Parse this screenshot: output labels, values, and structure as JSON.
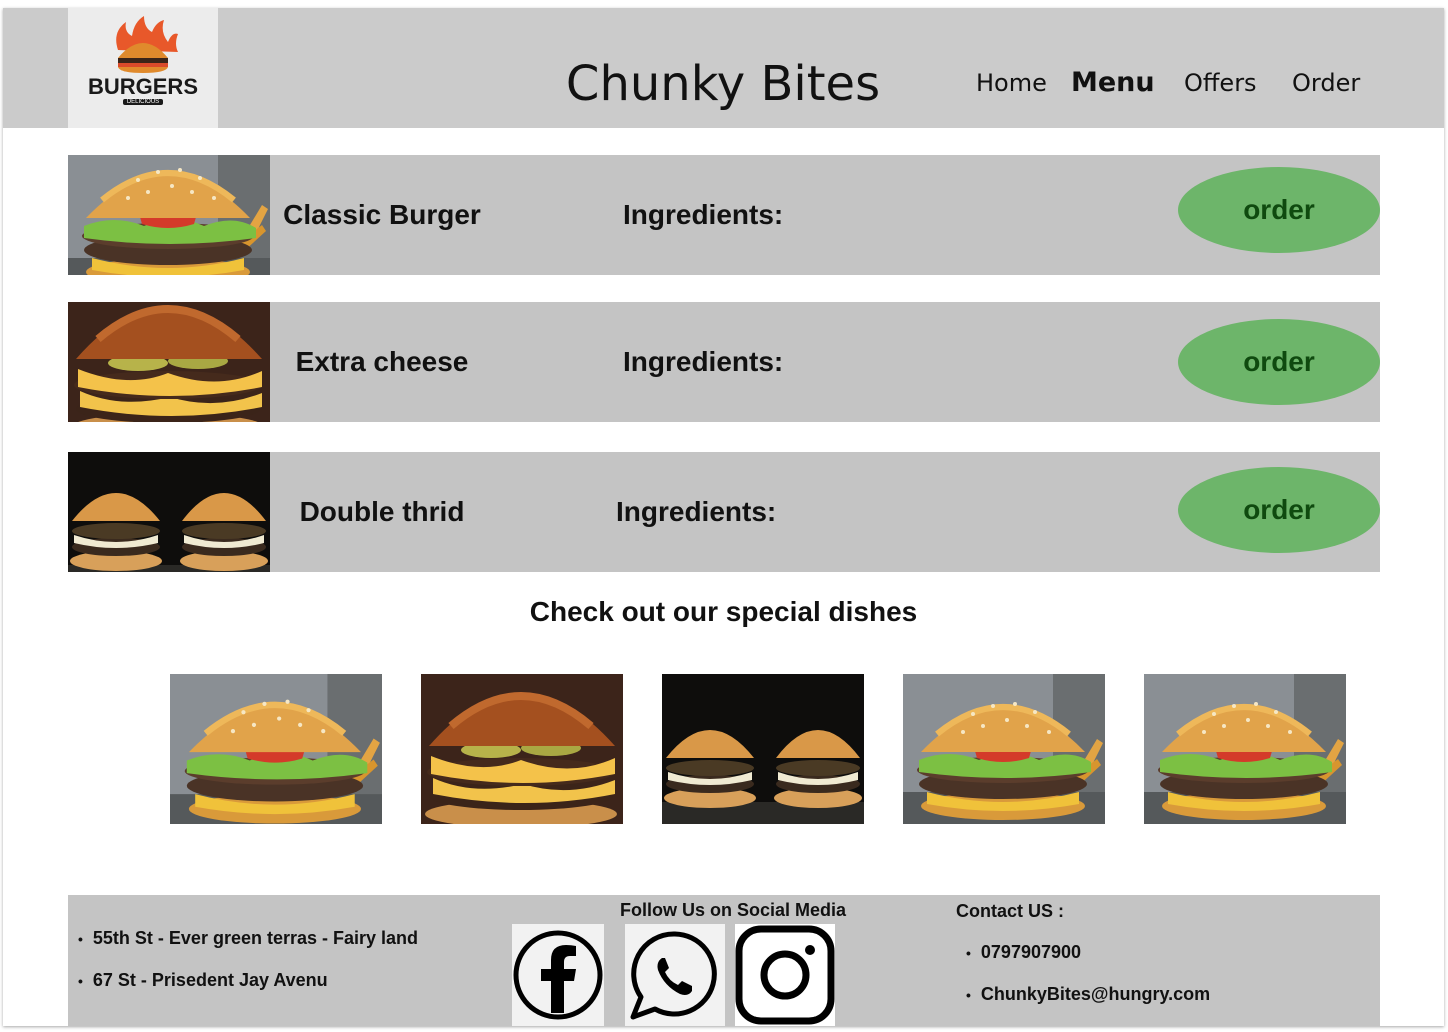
{
  "header": {
    "logo": {
      "word": "BURGERS",
      "tag": "DELICIOUS",
      "icon": "flaming-burger-logo"
    },
    "title": "Chunky Bites",
    "nav": [
      {
        "label": "Home",
        "active": false
      },
      {
        "label": "Menu",
        "active": true
      },
      {
        "label": "Offers",
        "active": false
      },
      {
        "label": "Order",
        "active": false
      }
    ]
  },
  "menu": {
    "items": [
      {
        "name": "Classic Burger",
        "ingredients_label": "Ingredients:",
        "order_label": "order",
        "image": "classic-burger-photo"
      },
      {
        "name": "Extra cheese",
        "ingredients_label": "Ingredients:",
        "order_label": "order",
        "image": "extra-cheese-burger-photo"
      },
      {
        "name": "Double thrid",
        "ingredients_label": "Ingredients:",
        "order_label": "order",
        "image": "double-burgers-photo"
      }
    ]
  },
  "special": {
    "title": "Check out our special dishes",
    "images": [
      "classic-burger-photo",
      "extra-cheese-burger-photo",
      "double-burgers-photo",
      "classic-burger-photo",
      "classic-burger-photo"
    ]
  },
  "footer": {
    "addresses": [
      "55th St - Ever green terras - Fairy land",
      "67 St - Prisedent Jay Avenu"
    ],
    "social_title": "Follow Us on Social Media",
    "social_icons": [
      "facebook-icon",
      "whatsapp-icon",
      "instagram-icon"
    ],
    "contact_title": "Contact US :",
    "contacts": [
      "0797907900",
      "ChunkyBites@hungry.com"
    ]
  },
  "colors": {
    "header_bg": "#cbcbcb",
    "row_bg": "#c4c4c4",
    "order_button": "#6db56a",
    "order_text": "#0f4a0f"
  }
}
